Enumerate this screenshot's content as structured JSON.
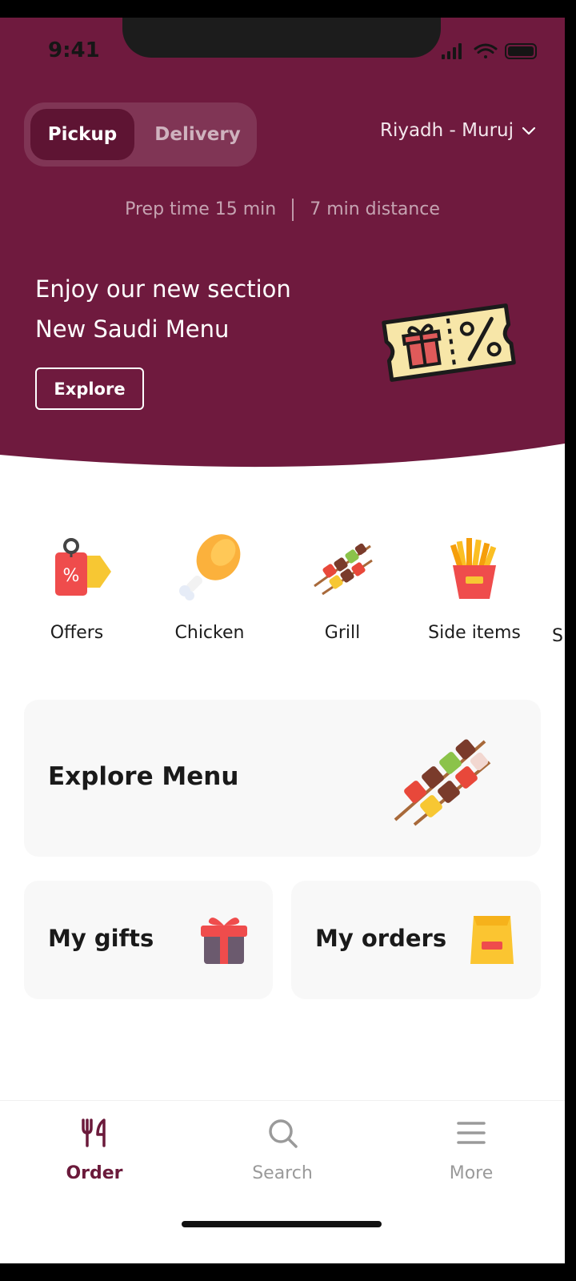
{
  "status_bar": {
    "time": "9:41"
  },
  "header": {
    "mode_toggle": {
      "active": "Pickup",
      "inactive": "Delivery"
    },
    "location": "Riyadh - Muruj",
    "prep_time": "Prep time 15 min",
    "distance": "7 min distance",
    "brand_color": "#6f1a3e"
  },
  "promo": {
    "line1": "Enjoy our new section",
    "line2": "New Saudi Menu",
    "button": "Explore"
  },
  "categories": [
    {
      "label": "Offers",
      "icon": "price-tag-icon"
    },
    {
      "label": "Chicken",
      "icon": "chicken-leg-icon"
    },
    {
      "label": "Grill",
      "icon": "skewer-icon"
    },
    {
      "label": "Side items",
      "icon": "fries-icon"
    },
    {
      "label": "S",
      "icon": ""
    }
  ],
  "cards": {
    "explore_menu": {
      "title": "Explore Menu",
      "icon": "skewer-icon"
    },
    "my_gifts": {
      "title": "My gifts",
      "icon": "gift-icon"
    },
    "my_orders": {
      "title": "My orders",
      "icon": "paper-bag-icon"
    }
  },
  "bottom_nav": [
    {
      "label": "Order",
      "icon": "fork-knife-icon",
      "active": true
    },
    {
      "label": "Search",
      "icon": "search-icon",
      "active": false
    },
    {
      "label": "More",
      "icon": "menu-icon",
      "active": false
    }
  ]
}
